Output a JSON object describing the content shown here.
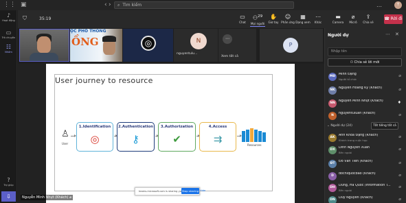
{
  "titlebar": {
    "search_placeholder": "Tìm kiếm",
    "avatar_initial": "T"
  },
  "rail": {
    "items": [
      {
        "label": "Hoạt động"
      },
      {
        "label": "Trò chuyện"
      },
      {
        "label": "Nhóm"
      },
      {
        "label": "Trợ giúp"
      }
    ]
  },
  "meeting": {
    "timer": "35:19",
    "controls": {
      "chat": "Chat",
      "people": "Mọi người",
      "people_count": "29",
      "raise": "Giơ tay",
      "react": "Phản ứng",
      "rooms": "Dạng xem",
      "more": "Khác",
      "camera": "Camera",
      "mic": "Micrô",
      "share": "Chia sẻ"
    },
    "leave_label": "Rời đi"
  },
  "videos": {
    "tile2_banner": "ỌC PHỔ THÔNG",
    "tile2_big": "ỒNG",
    "tile4_initial": "N",
    "tile4_name": "nguyentulu...",
    "tile5_name": "Xem tất cả",
    "tile6_initial": "P"
  },
  "slide": {
    "title": "User journey to resource",
    "steps": [
      {
        "label": "1.Identification"
      },
      {
        "label": "2.Authentication"
      },
      {
        "label": "3.Authorization"
      },
      {
        "label": "4.Access"
      }
    ],
    "user_label": "User",
    "resources_label": "Resources"
  },
  "share_bar": {
    "text": "teams.microsoft.com is sharing your screen.",
    "stop": "Stop sharing",
    "hide": "Hide"
  },
  "presenter_name": "Nguyễn Minh Nhựt (Khách)",
  "panel": {
    "title": "Người dự",
    "search_placeholder": "Nhập tên",
    "share_invite": "Chia sẻ lời mời",
    "organizers": [
      {
        "initials": "MĐ",
        "name": "Minh Đặng",
        "sub": "Người tổ chức",
        "color": "#5b6abf"
      },
      {
        "initials": "NK",
        "name": "Nguyễn Hoàng Kỳ (Khách)",
        "sub": "",
        "color": "#6f7ea8"
      },
      {
        "initials": "NN",
        "name": "Nguyễn Minh Nhựt (Khách)",
        "sub": "",
        "color": "#c75a6f"
      },
      {
        "initials": "N",
        "name": "nguyentuluan (Khách)",
        "sub": "",
        "color": "#c0612c"
      }
    ],
    "section_label": "Người dự (24)",
    "admit_all": "Tắt tiếng tất cả",
    "attendees": [
      {
        "initials": "AK",
        "name": "Anh Khoa Đặng (Khách)",
        "sub": "Khách trong cuộc họp",
        "color": "#9a7a2e"
      },
      {
        "initials": "DX",
        "name": "Dinh Nguyen Xuan",
        "sub": "Bên ngoài",
        "color": "#5f8f6a"
      },
      {
        "initials": "ĐT",
        "name": "Đỗ Văn Tiến (Khách)",
        "sub": "",
        "color": "#5b7fa8"
      },
      {
        "initials": "D",
        "name": "dochiquocbao (Khách)",
        "sub": "",
        "color": "#8a5fa8"
      },
      {
        "initials": "DH",
        "name": "Dung, Ha Quoc /Information T...",
        "sub": "Bên ngoài",
        "color": "#b05a9a"
      },
      {
        "initials": "DN",
        "name": "Duy Nguyễn (Khách)",
        "sub": "",
        "color": "#4e8a8a"
      }
    ]
  }
}
